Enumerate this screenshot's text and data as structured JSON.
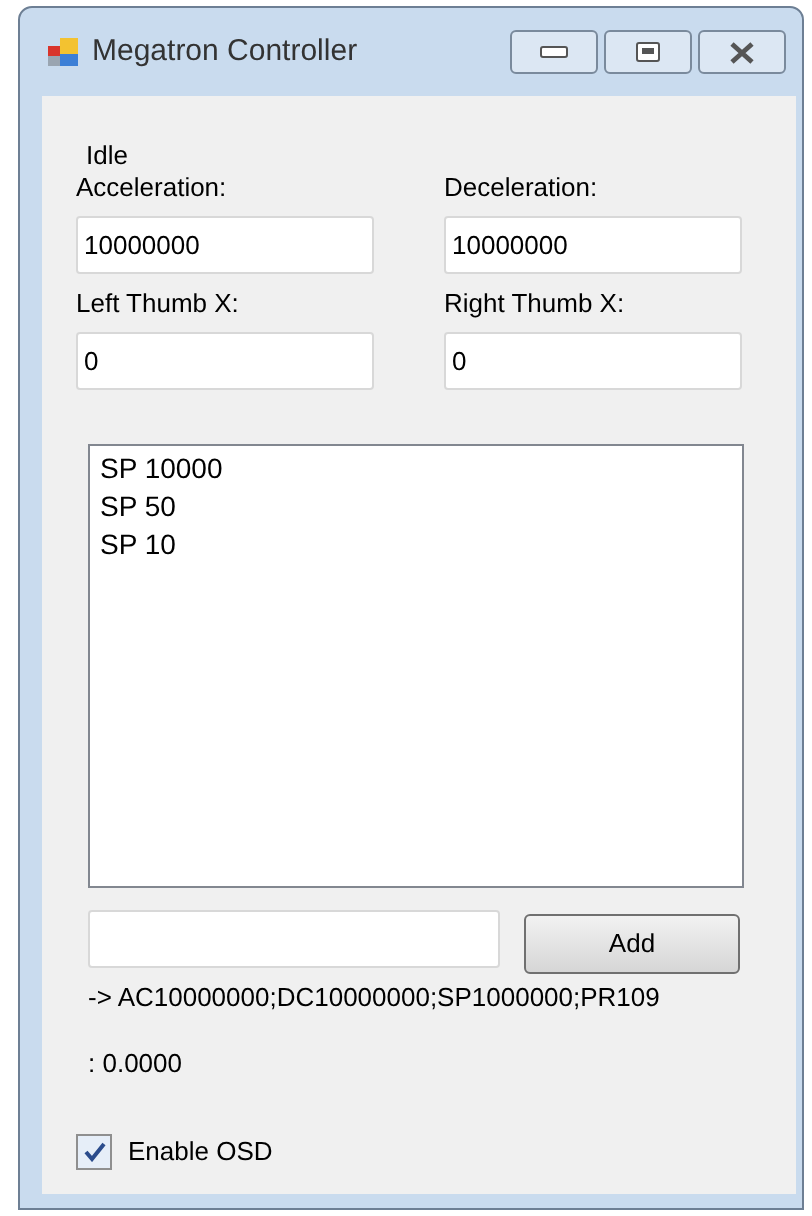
{
  "window": {
    "title": "Megatron Controller"
  },
  "status": "Idle",
  "fields": [
    {
      "label": "Acceleration:",
      "value": "10000000"
    },
    {
      "label": "Deceleration:",
      "value": "10000000"
    },
    {
      "label": "Left Thumb X:",
      "value": "0"
    },
    {
      "label": "Right Thumb X:",
      "value": "0"
    }
  ],
  "command_list": [
    "SP 10000",
    "SP 50",
    "SP 10"
  ],
  "add_button": "Add",
  "output": "-> AC10000000;DC10000000;SP1000000;PR109",
  "reading": ": 0.0000",
  "enable_osd": {
    "label": "Enable OSD",
    "checked": true
  }
}
